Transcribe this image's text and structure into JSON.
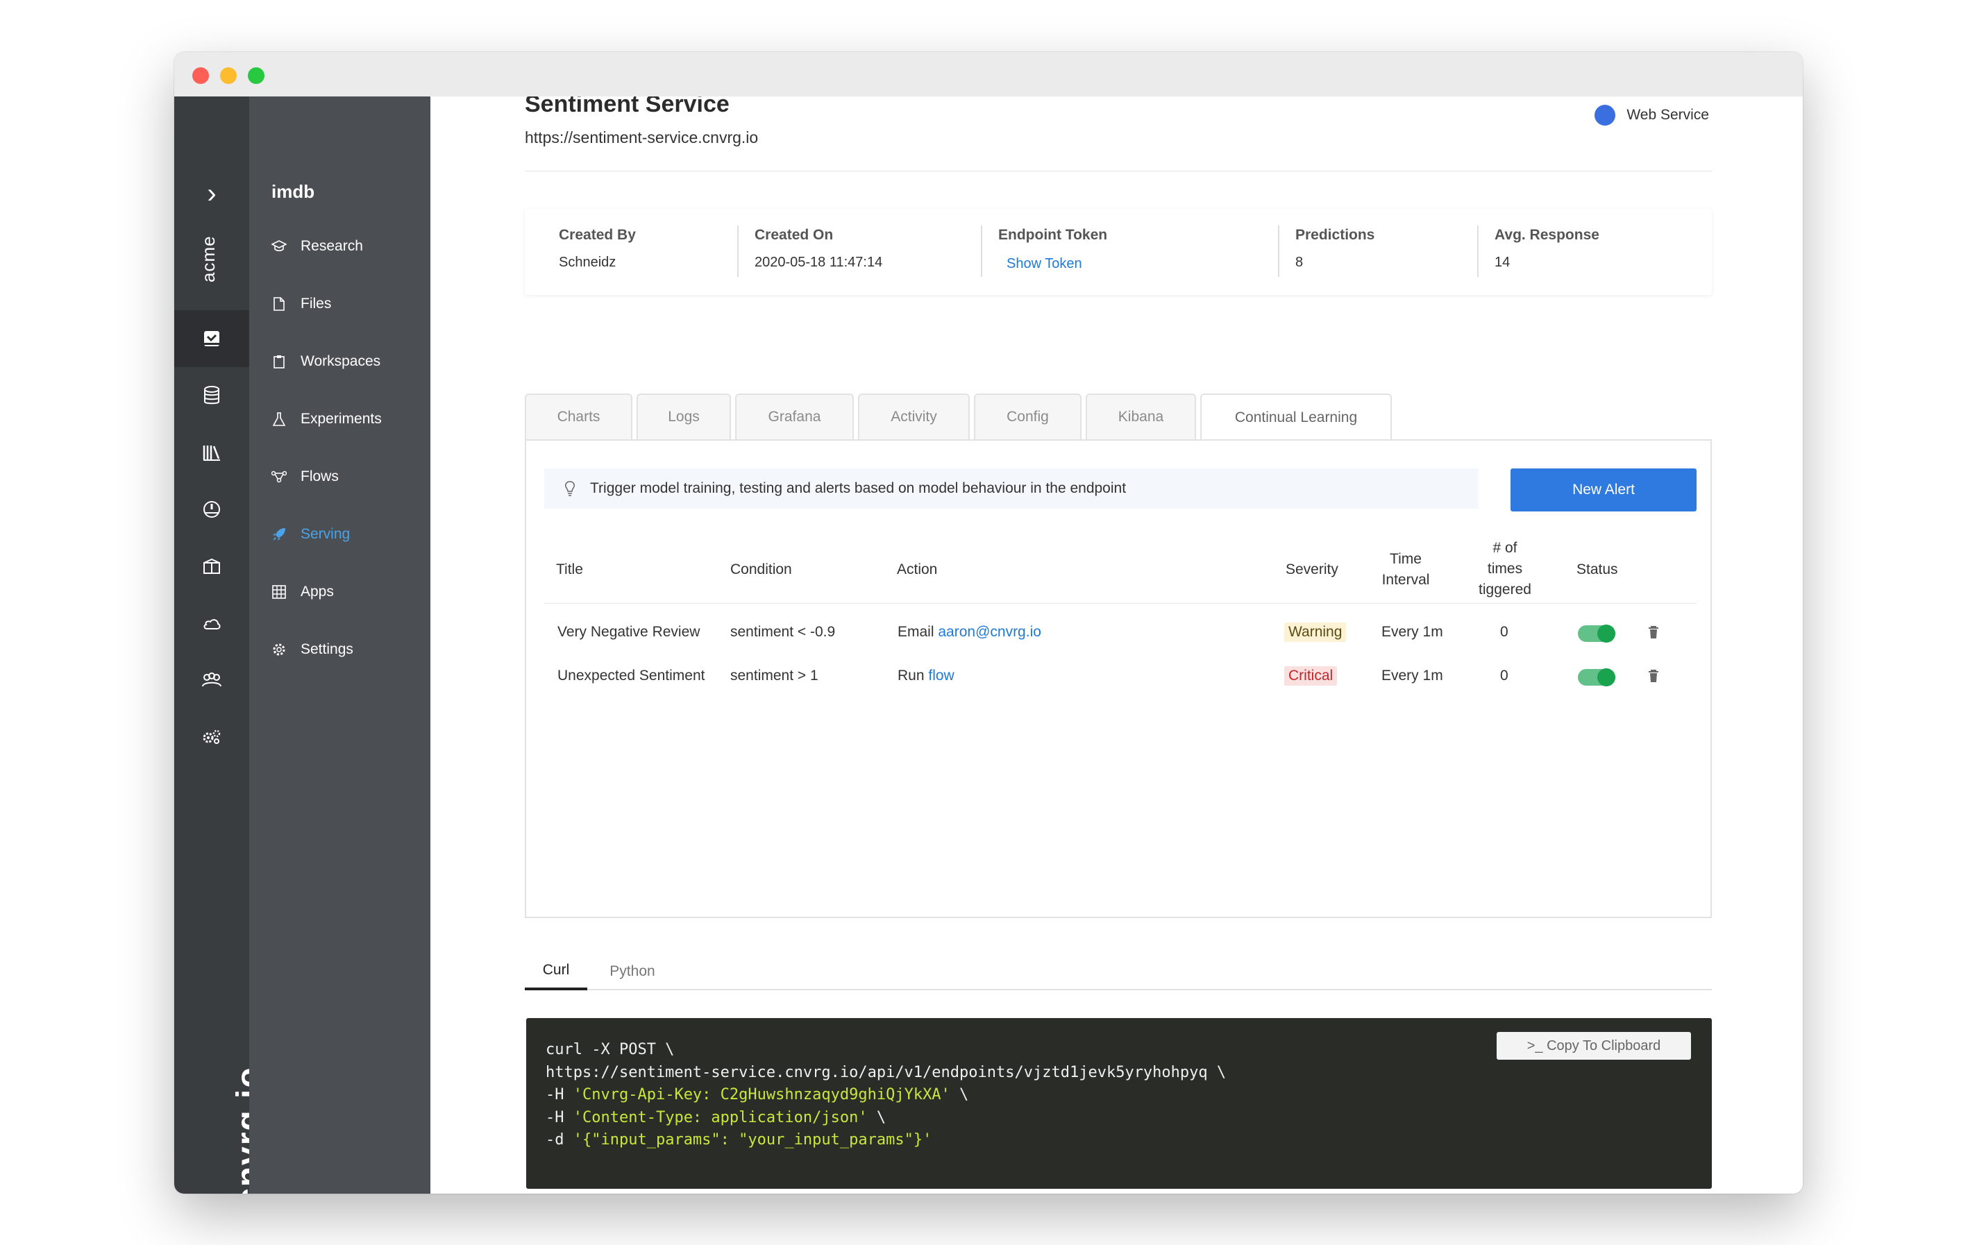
{
  "rail": {
    "organization": "acme",
    "logo_text": "cnvrg.io",
    "icons": [
      "projects-icon",
      "datasets-icon",
      "library-icon",
      "dashboard-icon",
      "containers-icon",
      "cloud-icon",
      "members-icon",
      "settings-gears-icon"
    ]
  },
  "nav": {
    "project": "imdb",
    "items": [
      {
        "label": "Research",
        "icon": "graduation-cap-icon"
      },
      {
        "label": "Files",
        "icon": "file-icon"
      },
      {
        "label": "Workspaces",
        "icon": "clipboard-icon"
      },
      {
        "label": "Experiments",
        "icon": "flask-icon"
      },
      {
        "label": "Flows",
        "icon": "flow-icon"
      },
      {
        "label": "Serving",
        "icon": "rocket-icon",
        "active": true
      },
      {
        "label": "Apps",
        "icon": "grid-icon"
      },
      {
        "label": "Settings",
        "icon": "gear-icon"
      }
    ],
    "active_color": "#4aa3e8"
  },
  "service": {
    "title": "Sentiment Service",
    "url": "https://sentiment-service.cnvrg.io",
    "type": "Web Service"
  },
  "info": {
    "created_by_label": "Created By",
    "created_by": "Schneidz",
    "created_on_label": "Created On",
    "created_on": "2020-05-18 11:47:14",
    "token_label": "Endpoint Token",
    "token_link": "Show Token",
    "predictions_label": "Predictions",
    "predictions": "8",
    "avg_response_label": "Avg. Response",
    "avg_response": "14"
  },
  "tabs": [
    "Charts",
    "Logs",
    "Grafana",
    "Activity",
    "Config",
    "Kibana",
    "Continual Learning"
  ],
  "active_tab": "Continual Learning",
  "alerts": {
    "hint": "Trigger model training, testing and alerts based on model behaviour in the endpoint",
    "new_alert_label": "New Alert",
    "columns": {
      "title": "Title",
      "condition": "Condition",
      "action": "Action",
      "severity": "Severity",
      "time_interval_1": "Time",
      "time_interval_2": "Interval",
      "triggered_1": "# of",
      "triggered_2": "times",
      "triggered_3": "tiggered",
      "status": "Status"
    },
    "rows": [
      {
        "title": "Very Negative Review",
        "condition": "sentiment < -0.9",
        "action_prefix": "Email",
        "action_link": "aaron@cnvrg.io",
        "severity": "Warning",
        "interval": "Every 1m",
        "triggered": "0",
        "enabled": true
      },
      {
        "title": "Unexpected Sentiment",
        "condition": "sentiment > 1",
        "action_prefix": "Run",
        "action_link": "flow",
        "severity": "Critical",
        "interval": "Every 1m",
        "triggered": "0",
        "enabled": true
      }
    ]
  },
  "code_tabs": [
    "Curl",
    "Python"
  ],
  "active_code_tab": "Curl",
  "code": {
    "copy_label": ">_ Copy To Clipboard",
    "line1": "curl -X POST \\",
    "line2": "https://sentiment-service.cnvrg.io/api/v1/endpoints/vjztd1jevk5yryhohpyq \\",
    "line3_flag": "-H ",
    "line3_str": "'Cnvrg-Api-Key: C2gHuwshnzaqyd9ghiQjYkXA'",
    "line3_end": " \\",
    "line4_flag": "-H ",
    "line4_str": "'Content-Type: application/json'",
    "line4_end": " \\",
    "line5_flag": "-d ",
    "line5_str": "'{\"input_params\": \"your_input_params\"}'"
  }
}
